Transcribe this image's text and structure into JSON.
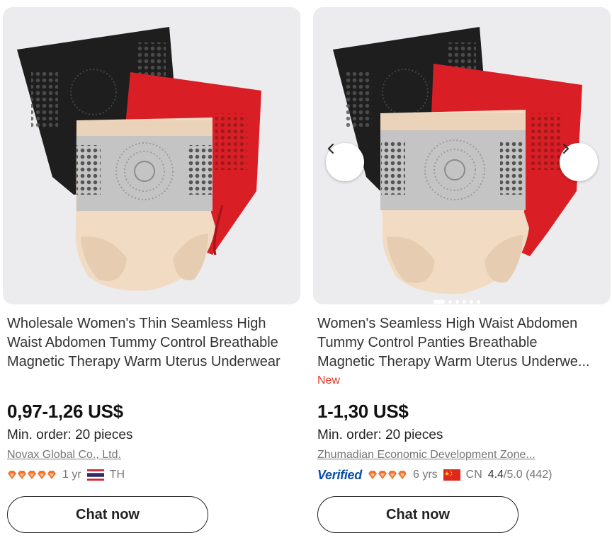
{
  "products": [
    {
      "title_lines": [
        "Wholesale Women's Thin Seamless High",
        "Waist Abdomen Tummy Control Breathable",
        "Magnetic Therapy Warm Uterus Underwear"
      ],
      "price": "0,97-1,26 US$",
      "moq": "Min. order: 20 pieces",
      "supplier": "Novax Global Co., Ltd.",
      "supplier_years": "1 yr",
      "country": "TH",
      "country_flag_icon": "thailand-flag-icon",
      "chat_label": "Chat now"
    },
    {
      "title_lines": [
        "Women's Seamless High Waist Abdomen",
        "Tummy Control Panties Breathable",
        "Magnetic Therapy Warm Uterus Underwe..."
      ],
      "badge": "New",
      "price": "1-1,30 US$",
      "moq": "Min. order: 20 pieces",
      "supplier": "Zhumadian Economic Development Zone...",
      "verified_label": "Verified",
      "supplier_years": "6 yrs",
      "country": "CN",
      "country_flag_icon": "china-flag-icon",
      "rating_score": "4.4",
      "rating_max": "/5.0",
      "rating_count": "(442)",
      "chat_label": "Chat now",
      "carousel_slides": 6,
      "carousel_active": 1
    }
  ],
  "colors": {
    "new_badge": "#e4392b",
    "verified": "#0a4ea8",
    "diamond": "#f0762d"
  }
}
